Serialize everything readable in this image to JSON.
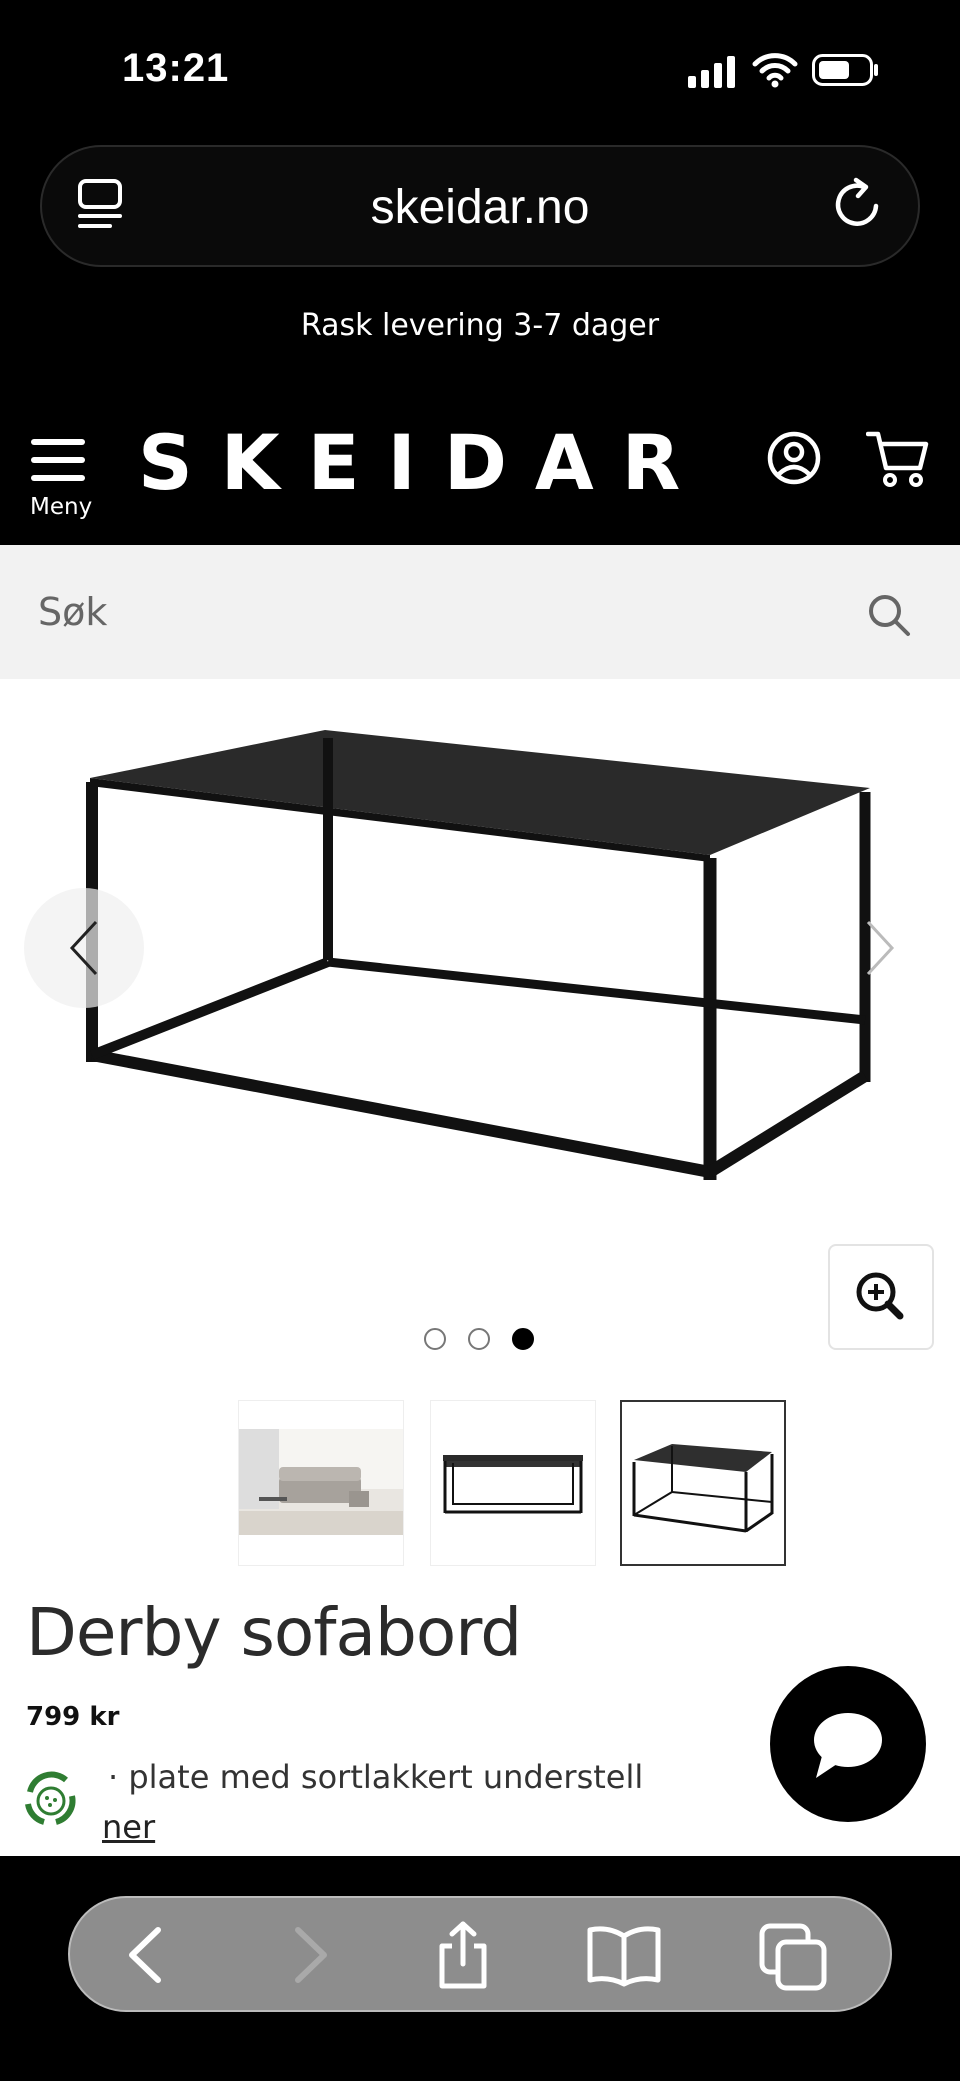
{
  "status_bar": {
    "time": "13:21"
  },
  "browser": {
    "url": "skeidar.no"
  },
  "promo": {
    "text": "Rask levering 3-7 dager"
  },
  "header": {
    "menu_label": "Meny",
    "logo_text": "SKEIDAR",
    "icons": [
      "menu-icon",
      "account-icon",
      "cart-icon"
    ]
  },
  "search": {
    "placeholder": "Søk"
  },
  "gallery": {
    "image_count": 3,
    "active_index": 3,
    "thumbnails": [
      "sofa-room-photo",
      "table-front-view",
      "table-angled-view"
    ]
  },
  "product": {
    "title": "Derby sofabord",
    "price": "799 kr",
    "description_visible": "· plate med sortlakkert understell",
    "link_visible": "ner"
  },
  "toolbar": {
    "icons": [
      "back-icon",
      "forward-icon",
      "share-icon",
      "bookmarks-icon",
      "tabs-icon"
    ]
  },
  "colors": {
    "header_bg": "#000000",
    "search_bg": "#f2f2f2",
    "toolbar_pill": "#8d8d8d"
  }
}
